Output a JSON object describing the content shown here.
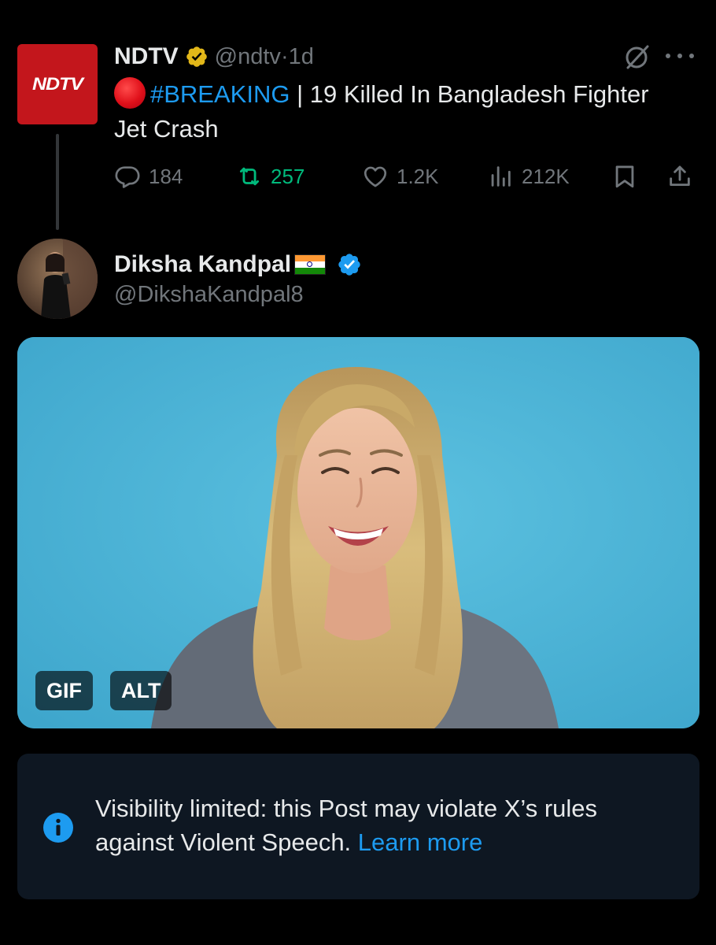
{
  "parent_tweet": {
    "avatar_logo_text": "NDTV",
    "display_name": "NDTV",
    "handle": "@ndtv",
    "separator": "·",
    "time": "1d",
    "verified_badge": "gold-verified-icon",
    "emoji": "red-circle-emoji",
    "hashtag": "#BREAKING",
    "text_after_hashtag": " | 19 Killed In Bangladesh Fighter Jet Crash",
    "stats": {
      "replies": "184",
      "reposts": "257",
      "likes": "1.2K",
      "views": "212K"
    },
    "icons": [
      "grok-icon",
      "more-icon",
      "reply-icon",
      "repost-icon",
      "like-icon",
      "views-icon",
      "bookmark-icon",
      "share-icon"
    ]
  },
  "reply": {
    "display_name": "Diksha Kandpal",
    "flag": "india-flag-emoji",
    "verified_badge": "blue-verified-icon",
    "handle": "@DikshaKandpal8",
    "media": {
      "type": "gif",
      "gif_badge": "GIF",
      "alt_badge": "ALT"
    }
  },
  "notice": {
    "icon": "info-icon",
    "text": "Visibility limited: this Post may violate X’s rules against Violent Speech.",
    "link": "Learn more"
  },
  "colors": {
    "background": "#000000",
    "text_primary": "#e7e9ea",
    "text_secondary": "#71767b",
    "accent_blue": "#1d9bf0",
    "repost_green": "#00ba7c",
    "ndtv_red": "#c3161c",
    "gold_badge": "#e2b719",
    "notice_bg": "#0e1722",
    "gif_background": "#4fb4d6"
  }
}
